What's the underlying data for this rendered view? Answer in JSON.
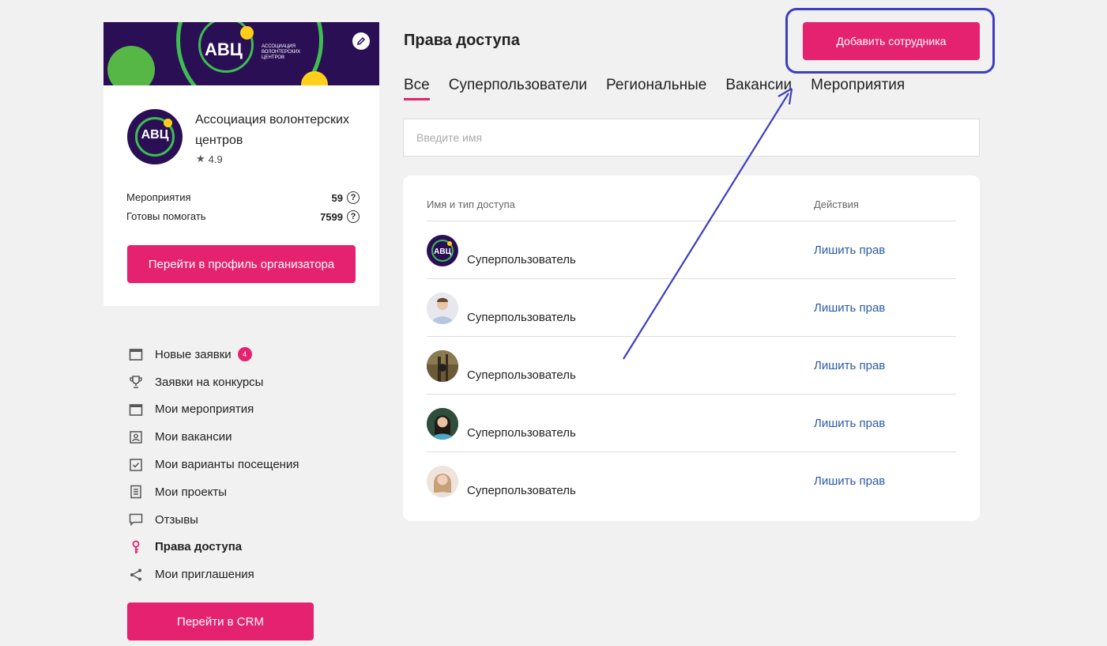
{
  "org": {
    "banner_logo": "АВЦ",
    "banner_subtitle": "Ассоциация волонтерских центров",
    "avatar_text": "АВЦ",
    "name": "Ассоциация волонтерских центров",
    "rating": "4.9",
    "stats": [
      {
        "label": "Мероприятия",
        "value": "59"
      },
      {
        "label": "Готовы помогать",
        "value": "7599"
      }
    ],
    "profile_button": "Перейти в профиль организатора"
  },
  "menu": {
    "items": [
      {
        "label": "Новые заявки",
        "icon": "calendar-icon",
        "badge": "4"
      },
      {
        "label": "Заявки на конкурсы",
        "icon": "trophy-icon"
      },
      {
        "label": "Мои мероприятия",
        "icon": "calendar-icon"
      },
      {
        "label": "Мои вакансии",
        "icon": "person-card-icon"
      },
      {
        "label": "Мои варианты посещения",
        "icon": "checkbox-icon"
      },
      {
        "label": "Мои проекты",
        "icon": "document-icon"
      },
      {
        "label": "Отзывы",
        "icon": "comment-icon"
      },
      {
        "label": "Права доступа",
        "icon": "key-icon",
        "active": true
      },
      {
        "label": "Мои приглашения",
        "icon": "share-icon"
      }
    ],
    "crm_button": "Перейти в CRM"
  },
  "main": {
    "title": "Права доступа",
    "add_button": "Добавить сотрудника",
    "tabs": [
      "Все",
      "Суперпользователи",
      "Региональные",
      "Вакансии",
      "Мероприятия"
    ],
    "search_placeholder": "Введите имя",
    "table": {
      "col_name": "Имя и тип доступа",
      "col_actions": "Действия",
      "rows": [
        {
          "role": "Суперпользователь",
          "action": "Лишить прав",
          "avatar": "org-logo"
        },
        {
          "role": "Суперпользователь",
          "action": "Лишить прав",
          "avatar": "user-photo"
        },
        {
          "role": "Суперпользователь",
          "action": "Лишить прав",
          "avatar": "user-photo"
        },
        {
          "role": "Суперпользователь",
          "action": "Лишить прав",
          "avatar": "user-photo"
        },
        {
          "role": "Суперпользователь",
          "action": "Лишить прав",
          "avatar": "user-photo"
        }
      ]
    }
  },
  "colors": {
    "accent": "#e4226f",
    "link": "#2b5aa8",
    "annotation": "#3c3fc0",
    "brand_purple": "#2b0f55"
  }
}
